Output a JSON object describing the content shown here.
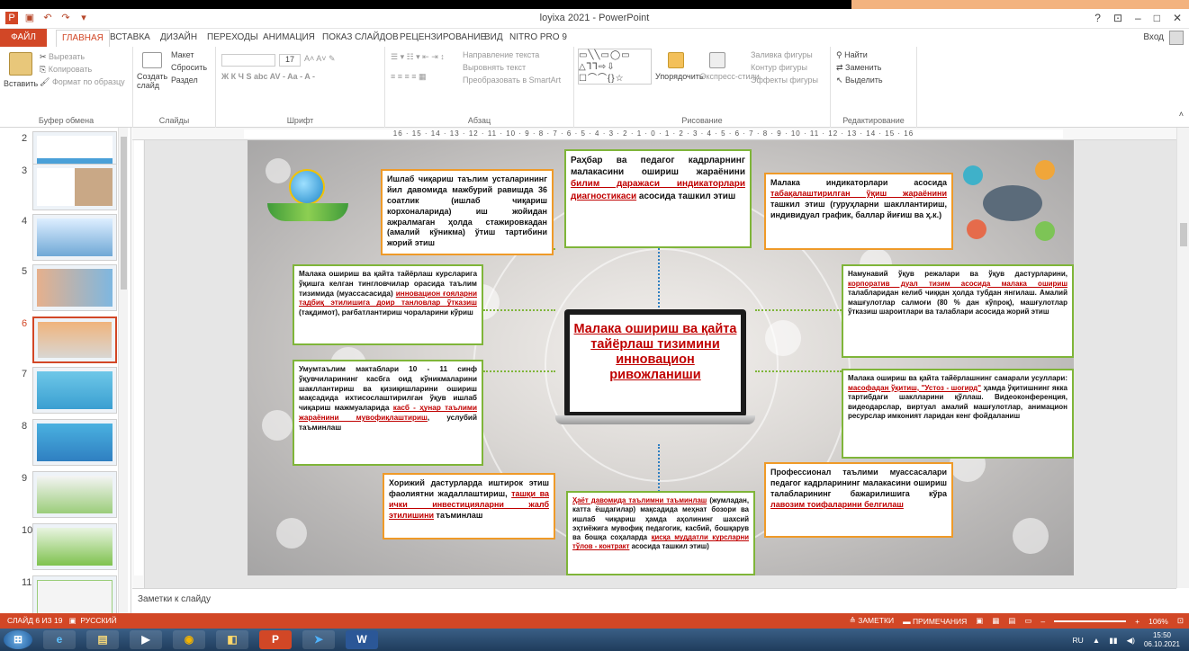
{
  "window": {
    "title": "loyixa 2021 - PowerPoint",
    "controls": [
      "?",
      "⊡",
      "–",
      "□",
      "✕"
    ]
  },
  "tabs": {
    "file": "ФАЙЛ",
    "items": [
      "ГЛАВНАЯ",
      "ВСТАВКА",
      "ДИЗАЙН",
      "ПЕРЕХОДЫ",
      "АНИМАЦИЯ",
      "ПОКАЗ СЛАЙДОВ",
      "РЕЦЕНЗИРОВАНИЕ",
      "ВИД",
      "NITRO PRO 9"
    ],
    "signin": "Вход"
  },
  "ribbon": {
    "clipboard": {
      "paste": "Вставить",
      "cut": "Вырезать",
      "copy": "Копировать",
      "format": "Формат по образцу",
      "label": "Буфер обмена"
    },
    "slides": {
      "create": "Создать слайд",
      "layout": "Макет",
      "reset": "Сбросить",
      "section": "Раздел",
      "label": "Слайды"
    },
    "font": {
      "size": "17",
      "label": "Шрифт"
    },
    "paragraph": {
      "direction": "Направление текста",
      "align": "Выровнять текст",
      "smartart": "Преобразовать в SmartArt",
      "label": "Абзац"
    },
    "drawing": {
      "arrange": "Упорядочить",
      "styles": "Экспресс-стили",
      "fill": "Заливка фигуры",
      "outline": "Контур фигуры",
      "effects": "Эффекты фигуры",
      "label": "Рисование"
    },
    "editing": {
      "find": "Найти",
      "replace": "Заменить",
      "select": "Выделить",
      "label": "Редактирование"
    }
  },
  "slide_panel": {
    "numbers": [
      "2",
      "3",
      "4",
      "5",
      "6",
      "7",
      "8",
      "9",
      "10",
      "11"
    ],
    "selected": "6"
  },
  "ruler": {
    "text": "16 · 15 · 14 · 13 · 12 · 11 · 10 · 9 · 8 · 7 · 6 · 5 · 4 · 3 · 2 · 1 · 0 · 1 · 2 · 3 · 4 · 5 · 6 · 7 · 8 · 9 · 10 · 11 · 12 · 13 · 14 · 15 · 16"
  },
  "slide": {
    "center_title": "Малака ошириш ва қайта тайёрлаш тизимини инновацион ривожланиши",
    "box_top_center": {
      "a": "Раҳбар ва педагог кадрларнинг малакасини ошириш жараёнини ",
      "r": "билим даражаси индикаторлари диагностикаси",
      "b": " асосида ташкил этиш"
    },
    "box_top_left": "Ишлаб чиқариш таълим усталарининг йил давомида мажбурий равишда 36 соатлик (ишлаб чиқариш корхоналарида) иш жойидан ажралмаган ҳолда стажировкадан (амалий кўникма) ўтиш тартибини жорий этиш",
    "box_top_right": {
      "a": "Малака индикаторлари асосида ",
      "r": "табақалаштирилган ўқиш жараёнини",
      "b": " ташкил этиш (гуруҳларни шакллантириш, индивидуал график, баллар йиғиш ва ҳ.к.)"
    },
    "box_mid_left": {
      "a": "Малака ошириш ва қайта тайёрлаш курсларига ўқишга келган тингловчилар орасида таълим тизимида (муассасасида) ",
      "r": "инновацион ғояларни тадбиқ этилишига доир танловлар ўтказиш",
      "b": " (тақдимот), рағбатлантириш чораларини кўриш"
    },
    "box_mid_right": {
      "a": "Намунавий ўқув режалари ва ўқув дастурларини, ",
      "r": "корпоратив дуал тизим асосида малака ошириш",
      "b": " талабларидан келиб чиққан ҳолда тубдан янгилаш. Амалий машғулотлар салмоғи (80 % дан кўпроқ), машғулотлар ўтказиш шароитлари ва талаблари асосида жорий этиш"
    },
    "box_low_left": {
      "a": "Умумтаълим мактаблари 10 - 11 синф ўқувчиларининг касбга оид кўникмаларини шакллантириш ва қизиқишларини ошириш мақсадида ихтисослаштирилган ўқув ишлаб чиқариш мажмуаларида ",
      "r": "касб - ҳунар таълими жараёнини мувофиқлаштириш",
      "b": ", услубий таъминлаш"
    },
    "box_low_right": {
      "a": "Малака ошириш ва қайта тайёрлашнинг самарали усуллари: ",
      "r": "масофадан ўқитиш, \"Устоз - шогирд\"",
      "b": " ҳамда ўқитишнинг якка тартибдаги шаклларини қўллаш. Видеоконференция, видеодарслар, виртуал амалий машғулотлар, анимацион ресурслар имконият ларидан кенг фойдаланиш"
    },
    "box_bottom_left": {
      "a": "Хорижий дастурларда иштирок этиш фаолиятни жадаллаштириш, ",
      "r": "ташқи ва ички инвестицияларни жалб этилишини",
      "b": " таъминлаш"
    },
    "box_bottom_center": {
      "r1": "Ҳаёт давомида таълимни таъминлаш",
      "a": " (жумладан, катта ёшдагилар) мақсадида меҳнат бозори ва ишлаб чиқариш ҳамда аҳолининг шахсий эҳтиёжига мувофиқ педагогик, касбий, бошқарув ва бошқа соҳаларда ",
      "r2": "қисқа муддатли курсларни тўлов - контракт",
      "b": " асосида ташкил этиш)"
    },
    "box_bottom_right": {
      "a": "Профессионал таълими муассасалари педагог кадрларининг малакасини ошириш талабларининг бажарилишига кўра ",
      "r": "лавозим тоифаларини белгилаш"
    }
  },
  "notes": {
    "placeholder": "Заметки к слайду"
  },
  "statusbar": {
    "slide_info": "СЛАЙД 6 ИЗ 19",
    "language": "РУССКИЙ",
    "notes_btn": "ЗАМЕТКИ",
    "comments_btn": "ПРИМЕЧАНИЯ",
    "zoom": "106%"
  },
  "taskbar": {
    "lang": "RU",
    "time": "15:50",
    "date": "06.10.2021"
  },
  "colors": {
    "accent": "#d24726",
    "green_border": "#7fb539",
    "orange_border": "#ef9a28",
    "red_text": "#c00000"
  }
}
